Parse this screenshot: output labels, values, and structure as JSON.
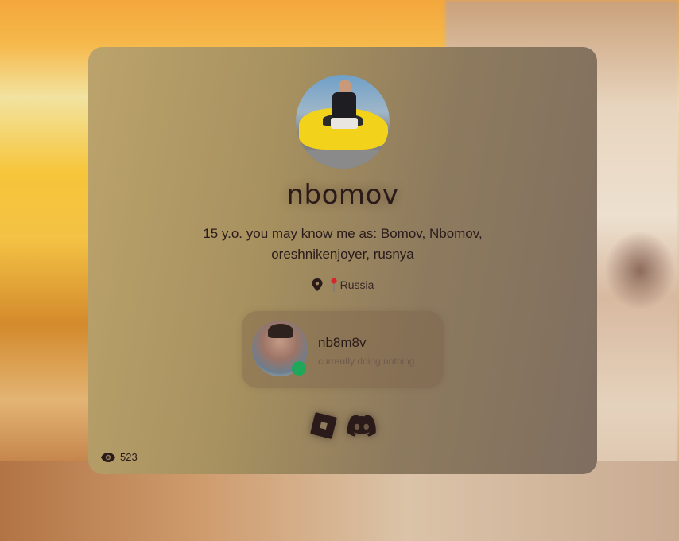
{
  "profile": {
    "username": "nbomov",
    "bio": "15 y.o. you may know me as: Bomov, Nbomov, oreshnikenjoyer, rusnya",
    "location": "Russia"
  },
  "presence": {
    "name": "nb8m8v",
    "status": "currently doing nothing",
    "status_color": "#1fa85a"
  },
  "socials": [
    {
      "icon": "roblox-icon"
    },
    {
      "icon": "discord-icon"
    }
  ],
  "views": {
    "count": "523"
  },
  "colors": {
    "text": "#2b1a1a",
    "card": "#a7915f"
  }
}
